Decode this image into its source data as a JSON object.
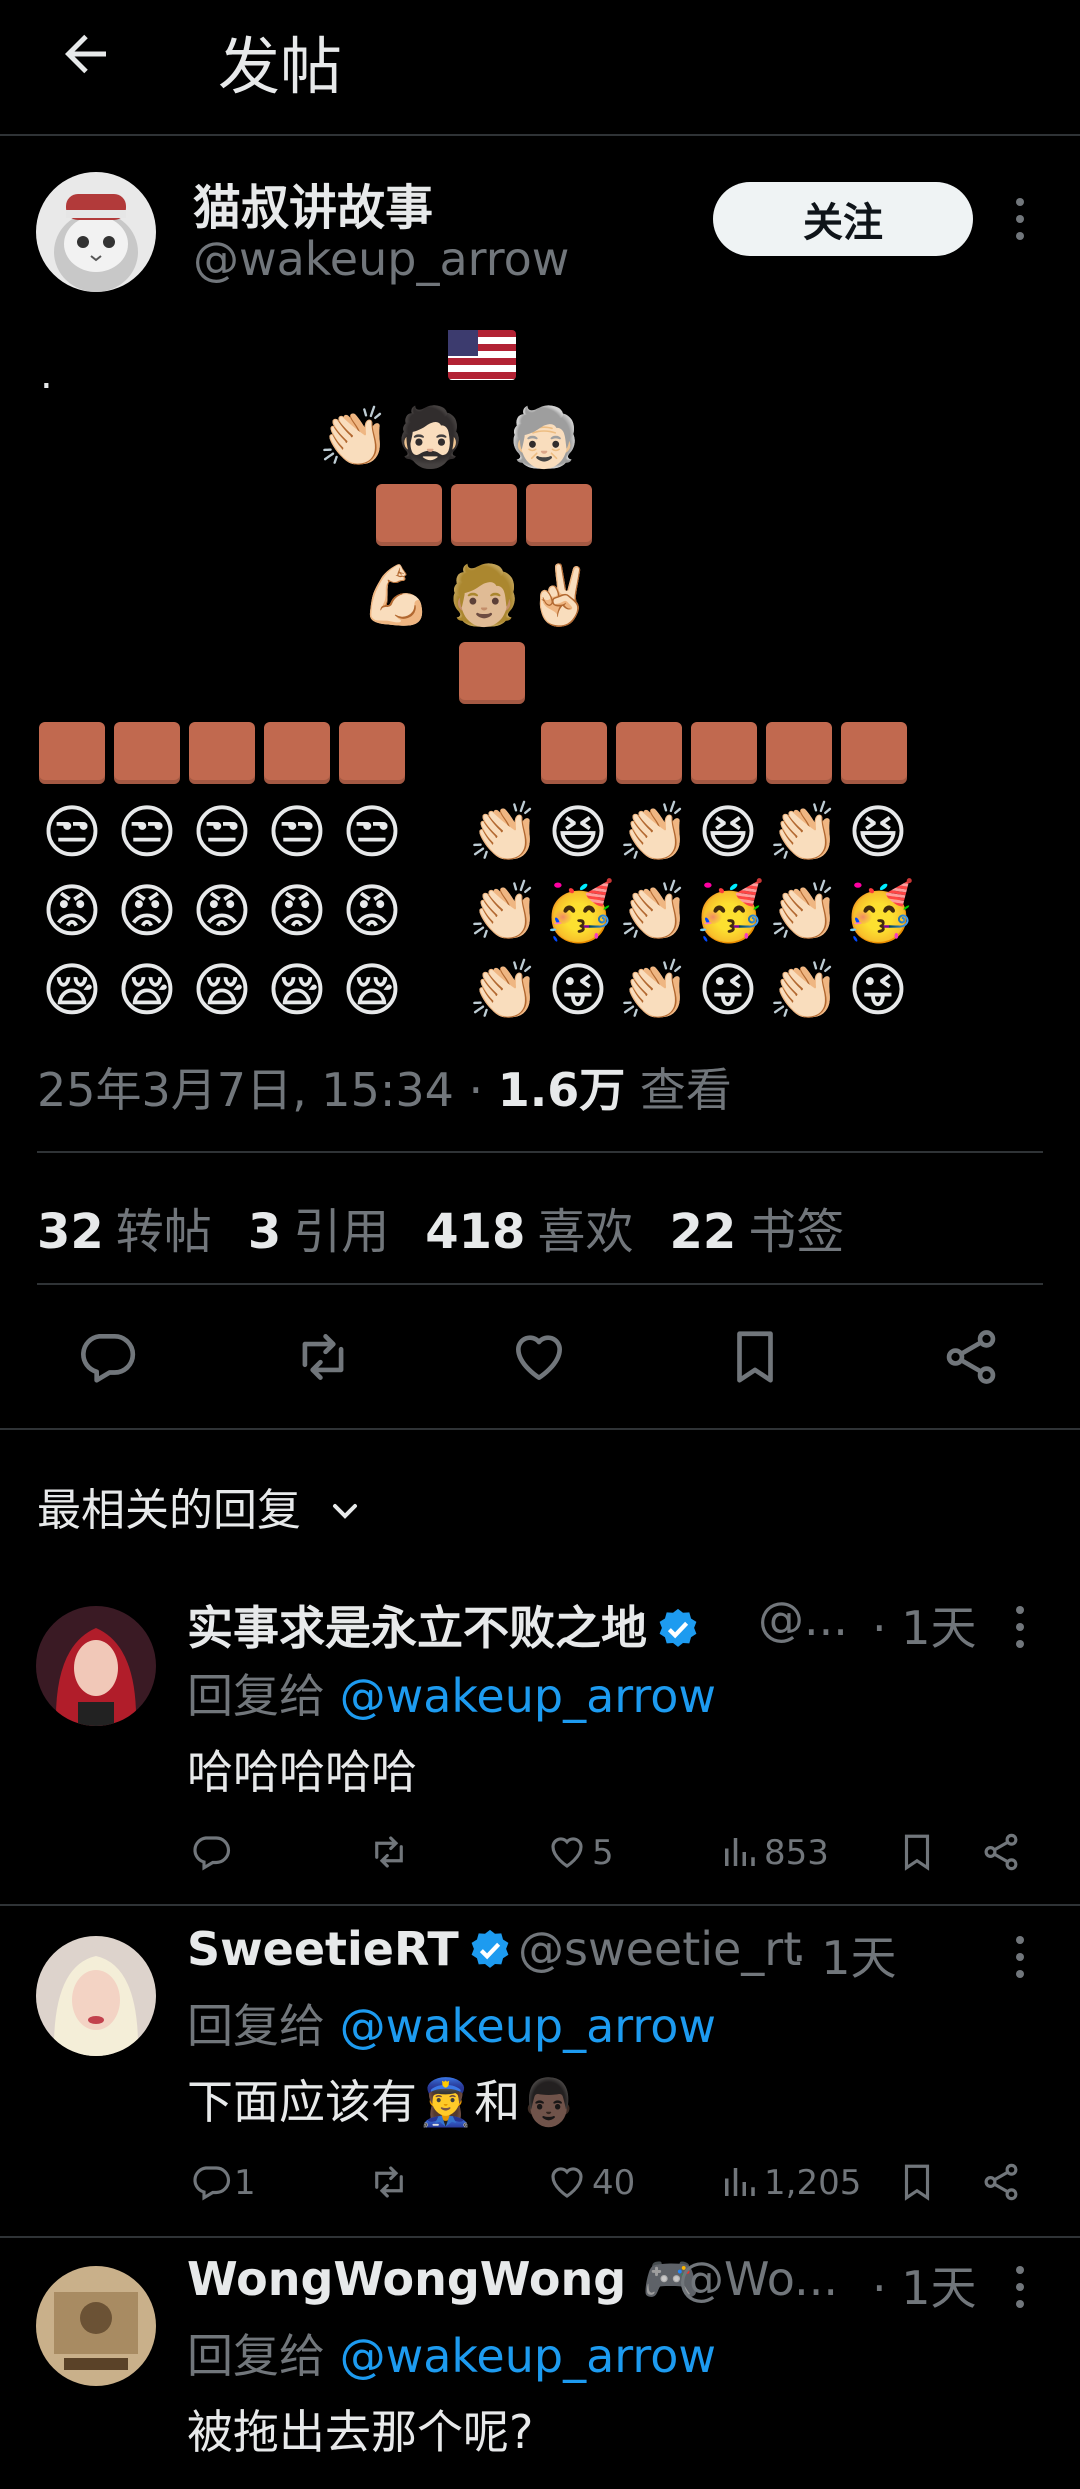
{
  "header": {
    "title": "发帖"
  },
  "post": {
    "author_name": "猫叔讲故事",
    "author_handle": "@wakeup_arrow",
    "follow_label": "关注",
    "body_dot": ".",
    "timestamp": "25年3月7日, 15:34 · ",
    "views_count": "1.6万",
    "views_label": " 查看",
    "stats": [
      {
        "count": "32",
        "label": "转帖"
      },
      {
        "count": "3",
        "label": "引用"
      },
      {
        "count": "418",
        "label": "喜欢"
      },
      {
        "count": "22",
        "label": "书签"
      }
    ],
    "emoji": {
      "clap": "👏🏻",
      "man_beard": "🧔🏻",
      "old_person": "🧓🏻",
      "muscle": "💪🏻",
      "person_blond": "🧑🏼",
      "victory": "✌🏻",
      "unamused": "😒",
      "angry": "😡",
      "sleepy": "😪",
      "laugh": "😆",
      "party": "🥳",
      "tongue": "😜"
    }
  },
  "replies_header": {
    "sort_label": "最相关的回复"
  },
  "replies": [
    {
      "name": "实事求是永立不败之地",
      "handle": "@...",
      "time": "· 1天",
      "reply_to_prefix": "回复给 ",
      "reply_to": "@wakeup_arrow",
      "text": "哈哈哈哈哈",
      "replies": "",
      "likes": "5",
      "views": "853"
    },
    {
      "name": "SweetieRT",
      "handle": "@sweetie_rt",
      "time": "· 1天",
      "reply_to_prefix": "回复给 ",
      "reply_to": "@wakeup_arrow",
      "text": "下面应该有",
      "text_emoji_1": "👮‍♀️",
      "text_mid": "和",
      "text_emoji_2": "👨🏿",
      "replies": "1",
      "likes": "40",
      "views": "1,205"
    },
    {
      "name": "WongWongWong",
      "name_emoji": "🎮",
      "handle": "@Wo...",
      "time": "· 1天",
      "reply_to_prefix": "回复给 ",
      "reply_to": "@wakeup_arrow",
      "text": "被拖出去那个呢?"
    }
  ],
  "colors": {
    "accent": "#1d9bf0",
    "background": "#000000",
    "divider": "#2f3336",
    "muted": "#71767b",
    "brick": "#c1694f"
  },
  "icons": [
    "back-arrow-icon",
    "more-vertical-icon",
    "reply-icon",
    "retweet-icon",
    "like-icon",
    "bookmark-icon",
    "share-icon",
    "views-icon",
    "verified-icon",
    "chevron-down-icon"
  ]
}
